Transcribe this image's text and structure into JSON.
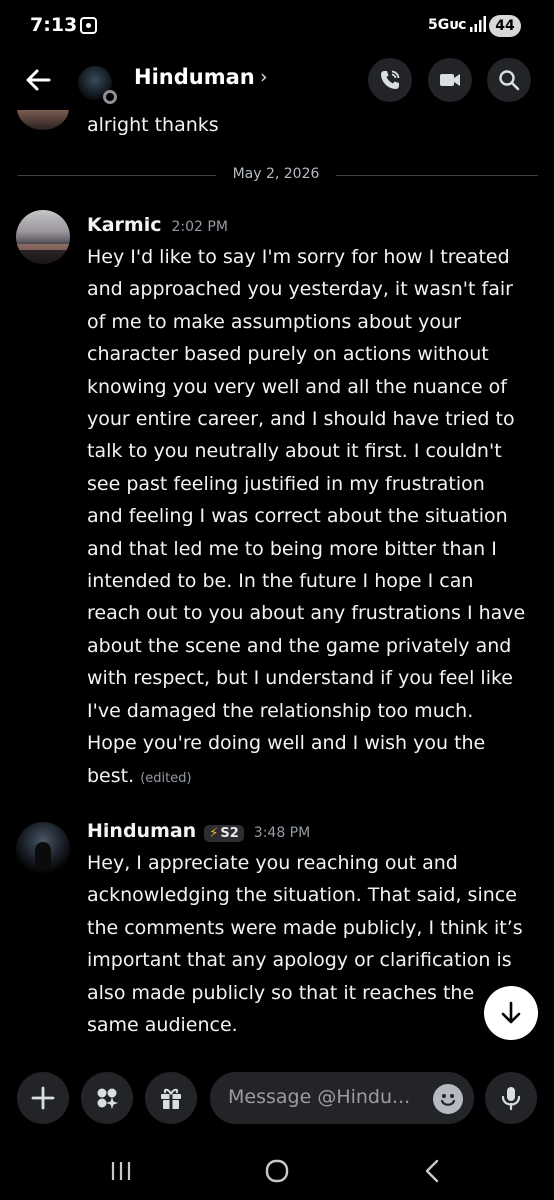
{
  "status_bar": {
    "time": "7:13",
    "network": "5Gᴜᴄ",
    "battery": "44"
  },
  "header": {
    "channel_name": "Hinduman",
    "chevron": "›",
    "icons": [
      "back-arrow-icon",
      "phone-call-icon",
      "video-camera-icon",
      "search-icon"
    ]
  },
  "previous_message": {
    "text": "alright thanks"
  },
  "date_divider": "May 2, 2026",
  "messages": [
    {
      "author": "Karmic",
      "timestamp": "2:02 PM",
      "lines": [
        "Hey I'd like to say I'm sorry for how I treated",
        "and approached you yesterday, it wasn't fair",
        "of me to make assumptions about your",
        "character based purely on actions without",
        "knowing you very well and all the nuance of",
        "your entire career, and I should have tried to",
        "talk to you neutrally about it first. I couldn't",
        "see past feeling justified in my frustration",
        "and feeling I was correct about the situation",
        "and that led me to being more bitter than I",
        "intended to be. In the future I hope I can",
        "reach out to you about any frustrations I have",
        "about the scene and the game privately and",
        "with respect, but I understand if you feel like",
        "I've damaged the relationship too much.",
        "Hope you're doing well and I wish you the",
        "best."
      ],
      "edited_label": "(edited)"
    },
    {
      "author": "Hinduman",
      "role_badge": "S2",
      "timestamp": "3:48 PM",
      "lines": [
        "Hey, I appreciate you reaching out and",
        "acknowledging the situation. That said, since",
        "the comments were made publicly, I think it’s",
        "important that any apology or clarification is",
        "also made publicly so that it reaches the",
        "same audience."
      ]
    }
  ],
  "input": {
    "placeholder": "Message @Hindu..."
  },
  "colors": {
    "background": "#000000",
    "surface": "#232428",
    "text": "#f2f3f5",
    "muted": "#949ba4",
    "badge_bolt": "#f0b232"
  }
}
